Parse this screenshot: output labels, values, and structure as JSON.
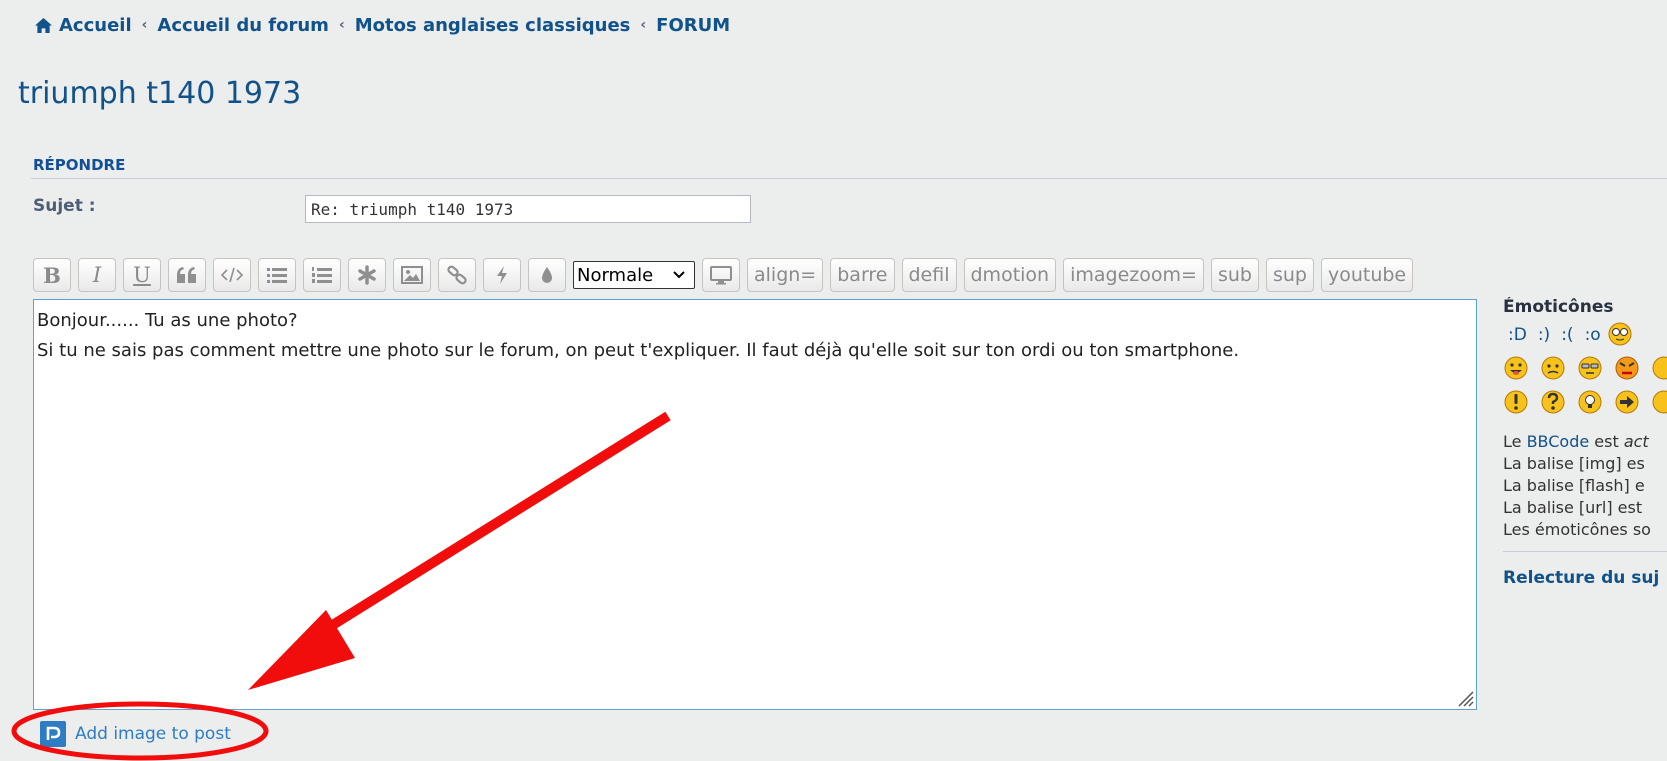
{
  "breadcrumb": {
    "items": [
      "Accueil",
      "Accueil du forum",
      "Motos anglaises classiques",
      "FORUM"
    ]
  },
  "topic": {
    "title": "triumph t140 1973"
  },
  "reply": {
    "section_title": "RÉPONDRE",
    "subject_label": "Sujet :",
    "subject_value": "Re: triumph t140 1973"
  },
  "toolbar": {
    "font_size": "Normale",
    "custom_buttons": [
      "align=",
      "barre",
      "defil",
      "dmotion",
      "imagezoom=",
      "sub",
      "sup",
      "youtube"
    ]
  },
  "editor": {
    "lines": [
      "Bonjour...... Tu as une photo?",
      "Si tu ne sais pas comment mettre une photo sur le forum, on peut t'expliquer. Il faut déjà qu'elle soit sur ton ordi ou ton smartphone."
    ]
  },
  "sidebar": {
    "smilies_title": "Émoticônes",
    "text_smilies": [
      ":D",
      ":)",
      ":(",
      ":o"
    ],
    "bbcode_info": {
      "bbcode_prefix": "Le ",
      "bbcode_link": "BBCode",
      "bbcode_suffix": " est ",
      "bbcode_status": "act",
      "img": "La balise [img] es",
      "flash": "La balise [flash] e",
      "url": "La balise [url] est",
      "smilies": "Les émoticônes so"
    },
    "review_link": "Relecture du suj"
  },
  "add_image": {
    "label": "Add image to post"
  },
  "colors": {
    "link": "#105289",
    "accent_blue": "#2e7dc4",
    "annotation_red": "#f20d0d",
    "background": "#eceded"
  }
}
